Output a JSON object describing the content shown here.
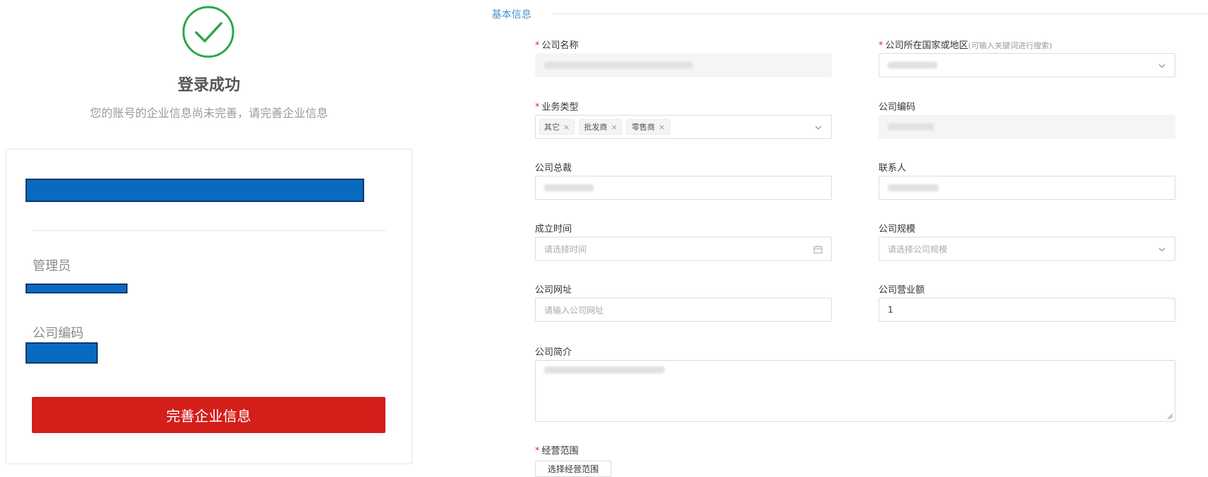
{
  "success_panel": {
    "title": "登录成功",
    "subtitle": "您的账号的企业信息尚未完善，请完善企业信息",
    "admin_label": "管理员",
    "company_code_label": "公司编码",
    "complete_button": "完善企业信息"
  },
  "form": {
    "section_title": "基本信息",
    "company_name": {
      "label": "公司名称",
      "required": "*"
    },
    "country": {
      "label": "公司所在国家或地区",
      "hint": "(可输入关键词进行搜索)",
      "required": "*"
    },
    "business_type": {
      "label": "业务类型",
      "required": "*",
      "tags": [
        "其它",
        "批发商",
        "零售商"
      ],
      "tag_remove": "×"
    },
    "company_code": {
      "label": "公司编码"
    },
    "president": {
      "label": "公司总裁"
    },
    "contact": {
      "label": "联系人"
    },
    "founded": {
      "label": "成立时间",
      "placeholder": "请选择时间"
    },
    "scale": {
      "label": "公司规模",
      "placeholder": "请选择公司规模"
    },
    "website": {
      "label": "公司网址",
      "placeholder": "请输入公司网址"
    },
    "revenue": {
      "label": "公司营业额",
      "value": "1"
    },
    "intro": {
      "label": "公司简介"
    },
    "scope": {
      "label": "经营范围",
      "required": "*",
      "button": "选择经营范围"
    }
  },
  "icons": {
    "success": "check-circle-icon",
    "dropdown": "chevron-down-icon",
    "calendar": "calendar-icon",
    "resize": "resize-handle-icon"
  },
  "colors": {
    "success_green": "#2aa84a",
    "primary_red": "#d31e1a",
    "section_blue": "#4a90c9",
    "required_red": "#e0302b",
    "redaction_blue": "#0a6ac2"
  }
}
